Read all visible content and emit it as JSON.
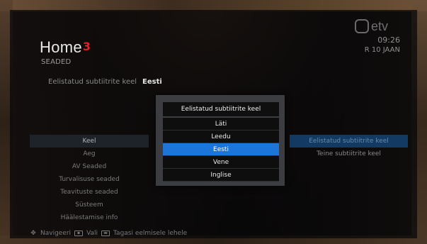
{
  "header": {
    "title": "Home",
    "title_mark": "3",
    "subtitle": "SEADED",
    "brand_logo": "etv",
    "time": "09:26",
    "date": "R 10 JAAN"
  },
  "current_setting": {
    "label": "Eelistatud subtiitrite keel",
    "value": "Eesti"
  },
  "menu": {
    "items": [
      {
        "label": "Keel",
        "active": true
      },
      {
        "label": "Aeg"
      },
      {
        "label": "AV Seaded"
      },
      {
        "label": "Turvalisuse seaded"
      },
      {
        "label": "Teavituste seaded"
      },
      {
        "label": "Süsteem"
      },
      {
        "label": "Häälestamise info"
      }
    ]
  },
  "right_panel": {
    "items": [
      {
        "label": "Eelistatud subtiitrite keel",
        "active": true
      },
      {
        "label": "Teine subtiitrite keel"
      }
    ]
  },
  "dialog": {
    "title": "Eelistatud subtiitrite keel",
    "options": [
      "Läti",
      "Leedu",
      "Eesti",
      "Vene",
      "Inglise"
    ],
    "selected": "Eesti"
  },
  "footer": {
    "navigate": "Navigeeri",
    "select_key": "OK",
    "select": "Vali",
    "back_key": "BACK",
    "back": "Tagasi eelmisele lehele"
  },
  "colors": {
    "accent": "#1c76d9",
    "brand_red": "#e2202a"
  }
}
